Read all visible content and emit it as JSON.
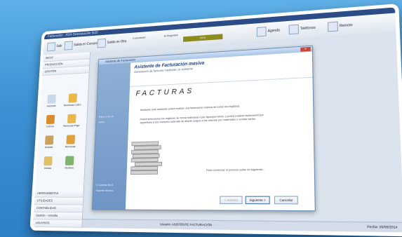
{
  "window": {
    "title": "Facturación · 2014 Demostración SUD"
  },
  "toolbar": {
    "btn1": "Salir",
    "btn2": "Salida en Comunidad",
    "btn3": "Salida en Otra",
    "field1": "Comunidad",
    "field2": "El Regentes",
    "period": "2014",
    "agenda": "Agenda",
    "telefonos": "Teléfonos",
    "remoto": "Remoto"
  },
  "sidebar": {
    "items": [
      "INICIO",
      "PRODUCCIÓN",
      "GESTIÓN"
    ],
    "grid": [
      "Facturas",
      "Remesas Cobro",
      "Cobros",
      "Remesas Pago",
      "Aceptar",
      "Remesas",
      "Ventas",
      "Recibos"
    ],
    "bottom": [
      "HERRAMIENTAS",
      "UTILIDADES",
      "CONTABILIDAD",
      "Gestión - consulta",
      "USUARIOS"
    ]
  },
  "dialog": {
    "title": "Asistente de Facturación",
    "heading": "Asistente de Facturación masiva",
    "subheading": "Generación de facturas mediante un asistente",
    "big_word": "FACTURAS",
    "para1": "Mediante este asistente podrá realizar una facturación masiva de todos los registros.",
    "para2": "Podrá seleccionar los registros de forma individual o por tipos/permisos, y podrá realizar facturación por superficies o por consumo además de añadir cargos a las mismas por materiales o cuotas varias.",
    "continue": "Para comenzar el proceso pulse en siguiente...",
    "side1": "Paso 1 de 10",
    "side2": "Inicio",
    "side3": "© Cuenta 2014",
    "side4": "Soporte técnico",
    "btn_back": "< Anterior",
    "btn_next": "Siguiente >",
    "btn_cancel": "Cancelar"
  },
  "status": {
    "left": "Usuario: ASISTENTE FACTURACIÓN",
    "right": "Fecha: 25/05/2014"
  }
}
